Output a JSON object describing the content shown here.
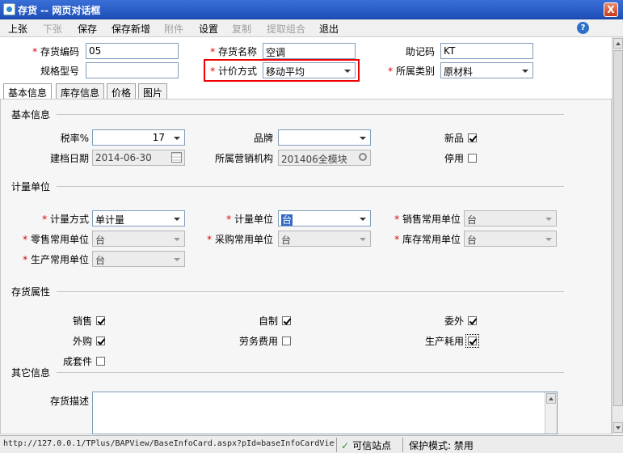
{
  "window": {
    "title": "存货 -- 网页对话框",
    "close": "X"
  },
  "menu": {
    "items": [
      {
        "label": "上张",
        "disabled": false
      },
      {
        "label": "下张",
        "disabled": true
      },
      {
        "label": "保存",
        "disabled": false
      },
      {
        "label": "保存新增",
        "disabled": false
      },
      {
        "label": "附件",
        "disabled": true
      },
      {
        "label": "设置",
        "disabled": false
      },
      {
        "label": "复制",
        "disabled": true
      },
      {
        "label": "提取组合",
        "disabled": true
      },
      {
        "label": "退出",
        "disabled": false
      }
    ],
    "help": "?"
  },
  "header": {
    "code_label": "存货编码",
    "code": "05",
    "name_label": "存货名称",
    "name": "空调",
    "mnemonic_label": "助记码",
    "mnemonic": "KT",
    "spec_label": "规格型号",
    "spec": "",
    "pricing_label": "计价方式",
    "pricing": "移动平均",
    "category_label": "所属类别",
    "category": "原材料"
  },
  "tabs": [
    "基本信息",
    "库存信息",
    "价格",
    "图片"
  ],
  "basic": {
    "section": "基本信息",
    "tax_label": "税率%",
    "tax": "17",
    "brand_label": "品牌",
    "brand": "",
    "new_label": "新品",
    "new_checked": true,
    "date_label": "建档日期",
    "date": "2014-06-30",
    "org_label": "所属营销机构",
    "org": "201406全模块",
    "stop_label": "停用",
    "stop_checked": false
  },
  "unit": {
    "section": "计量单位",
    "method_label": "计量方式",
    "method": "单计量",
    "unit_label": "计量单位",
    "unit": "台",
    "sale_label": "销售常用单位",
    "sale": "台",
    "retail_label": "零售常用单位",
    "retail": "台",
    "purchase_label": "采购常用单位",
    "purchase": "台",
    "stock_label": "库存常用单位",
    "stock": "台",
    "production_label": "生产常用单位",
    "production": "台"
  },
  "attrs": {
    "section": "存货属性",
    "items": [
      {
        "label": "销售",
        "checked": true
      },
      {
        "label": "自制",
        "checked": true
      },
      {
        "label": "委外",
        "checked": true
      },
      {
        "label": "外购",
        "checked": true
      },
      {
        "label": "劳务费用",
        "checked": false
      },
      {
        "label": "生产耗用",
        "checked": true
      },
      {
        "label": "成套件",
        "checked": false
      }
    ]
  },
  "other": {
    "section": "其它信息",
    "desc_label": "存货描述",
    "desc": ""
  },
  "status": {
    "url": "http://127.0.0.1/TPlus/BAPView/BaseInfoCard.aspx?pId=baseInfoCardView",
    "check": "✓",
    "zone": "可信站点",
    "protect": "保护模式: 禁用"
  }
}
